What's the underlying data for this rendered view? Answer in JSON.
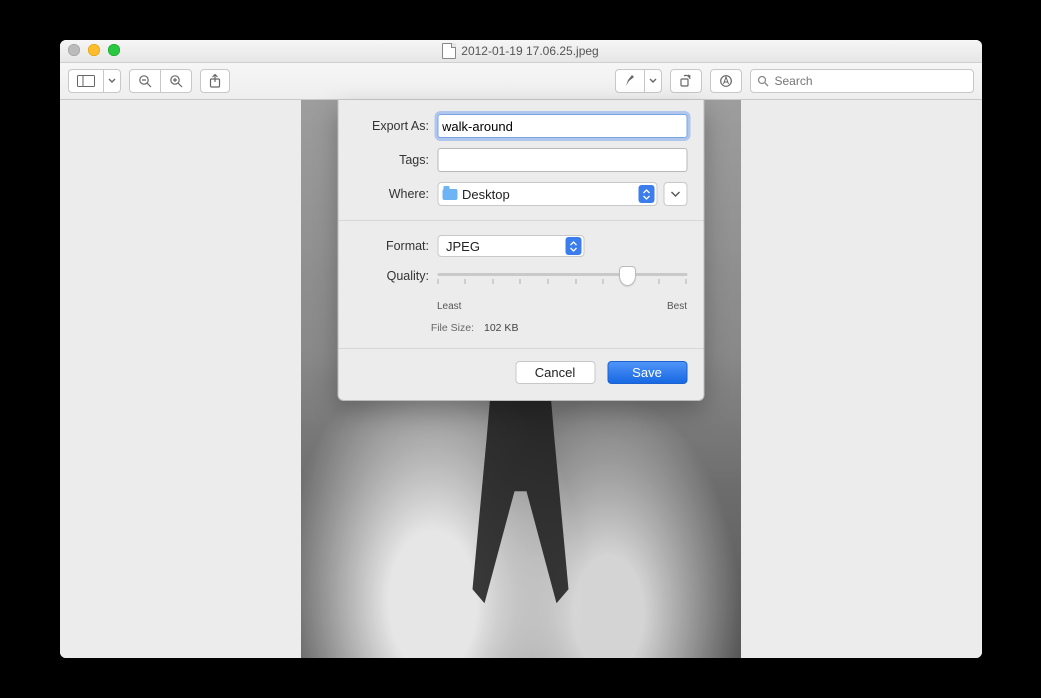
{
  "window": {
    "title": "2012-01-19 17.06.25.jpeg"
  },
  "toolbar": {
    "search_placeholder": "Search"
  },
  "sheet": {
    "export_as_label": "Export As:",
    "export_as_value": "walk-around",
    "tags_label": "Tags:",
    "tags_value": "",
    "where_label": "Where:",
    "where_value": "Desktop",
    "format_label": "Format:",
    "format_value": "JPEG",
    "quality_label": "Quality:",
    "quality_least": "Least",
    "quality_best": "Best",
    "file_size_label": "File Size:",
    "file_size_value": "102 KB",
    "cancel": "Cancel",
    "save": "Save"
  }
}
